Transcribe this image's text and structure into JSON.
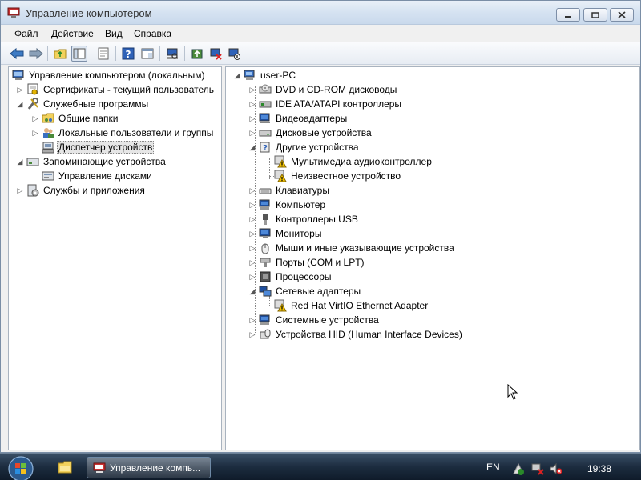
{
  "window": {
    "title": "Управление компьютером",
    "controls": {
      "minimize": "minimize",
      "maximize": "maximize",
      "close": "close"
    }
  },
  "menu": [
    "Файл",
    "Действие",
    "Вид",
    "Справка"
  ],
  "toolbar_icons": [
    "back-arrow-icon",
    "forward-arrow-icon",
    "up-folder-icon",
    "show-hide-tree-icon",
    "properties-icon",
    "help-icon",
    "console-view-icon",
    "scan-hardware-icon",
    "update-driver-icon",
    "uninstall-icon",
    "disable-device-icon"
  ],
  "left_tree": {
    "root": "Управление компьютером (локальным)",
    "items": [
      {
        "label": "Сертификаты - текущий пользователь",
        "icon": "certificate-icon"
      },
      {
        "label": "Служебные программы",
        "icon": "tools-icon"
      },
      {
        "label": "Общие папки",
        "icon": "shared-folder-icon"
      },
      {
        "label": "Локальные пользователи и группы",
        "icon": "users-icon"
      },
      {
        "label": "Диспетчер устройств",
        "icon": "device-manager-icon",
        "selected": true
      },
      {
        "label": "Запоминающие устройства",
        "icon": "storage-icon"
      },
      {
        "label": "Управление дисками",
        "icon": "disk-management-icon"
      },
      {
        "label": "Службы и приложения",
        "icon": "services-icon"
      }
    ]
  },
  "right_tree": {
    "root": "user-PC",
    "items": [
      {
        "label": "DVD и CD-ROM дисководы",
        "icon": "dvd-icon"
      },
      {
        "label": "IDE ATA/ATAPI контроллеры",
        "icon": "ide-controller-icon"
      },
      {
        "label": "Видеоадаптеры",
        "icon": "display-adapter-icon"
      },
      {
        "label": "Дисковые устройства",
        "icon": "disk-drive-icon"
      },
      {
        "label": "Другие устройства",
        "icon": "other-devices-icon"
      },
      {
        "label": "Мультимедиа аудиоконтроллер",
        "icon": "warning-device-icon"
      },
      {
        "label": "Неизвестное устройство",
        "icon": "warning-device-icon"
      },
      {
        "label": "Клавиатуры",
        "icon": "keyboard-icon"
      },
      {
        "label": "Компьютер",
        "icon": "computer-icon"
      },
      {
        "label": "Контроллеры USB",
        "icon": "usb-icon"
      },
      {
        "label": "Мониторы",
        "icon": "monitor-icon"
      },
      {
        "label": "Мыши и иные указывающие устройства",
        "icon": "mouse-icon"
      },
      {
        "label": "Порты (COM и LPT)",
        "icon": "port-icon"
      },
      {
        "label": "Процессоры",
        "icon": "processor-icon"
      },
      {
        "label": "Сетевые адаптеры",
        "icon": "network-adapter-icon"
      },
      {
        "label": "Red Hat VirtIO Ethernet Adapter",
        "icon": "warning-device-icon"
      },
      {
        "label": "Системные устройства",
        "icon": "system-devices-icon"
      },
      {
        "label": "Устройства HID (Human Interface Devices)",
        "icon": "hid-icon"
      }
    ]
  },
  "taskbar": {
    "task_label": "Управление компь...",
    "language": "EN",
    "time": "19:38"
  },
  "colors": {
    "selection": "#e6e6e6",
    "taskbar": "#1c2c3f",
    "warning": "#f2c200"
  }
}
